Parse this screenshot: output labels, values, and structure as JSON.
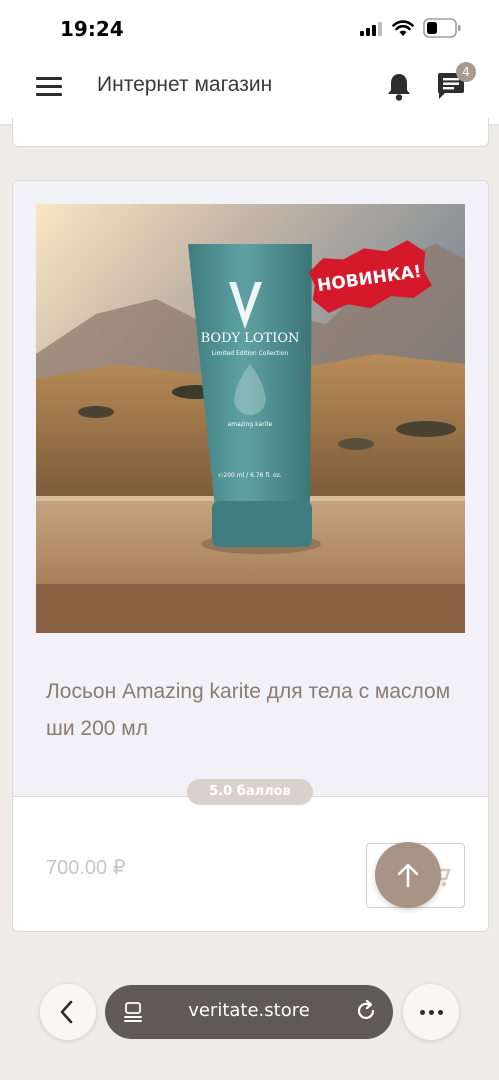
{
  "status_bar": {
    "time": "19:24"
  },
  "header": {
    "title": "Интернет магазин",
    "menu_icon": "hamburger-menu-icon",
    "notifications_icon": "bell-icon",
    "messages_icon": "chat-icon",
    "messages_badge": "4"
  },
  "product": {
    "name": "Лосьон Amazing karite для тела с маслом ши 200 мл",
    "rating": "5.0 баллов",
    "price": "700.00 ₽",
    "image": {
      "package_title": "BODY LOTION",
      "package_subtitle": "Limited Edition Collection",
      "package_line": "amazing karite",
      "package_volume": "℮200 ml / 6.76 fl. oz.",
      "sticker": "НОВИНКА!"
    },
    "cart_icon": "shopping-cart-icon"
  },
  "browser": {
    "url": "veritate.store",
    "back_icon": "chevron-left-icon",
    "tabs_icon": "tab-icon",
    "reload_icon": "reload-icon",
    "more_icon": "more-horizontal-icon"
  },
  "colors": {
    "accent": "#a89484",
    "page_background": "#efebe8",
    "card_tint": "#f2f1f8",
    "product_name": "#8a7c73",
    "address_bar": "#5f5a55"
  }
}
